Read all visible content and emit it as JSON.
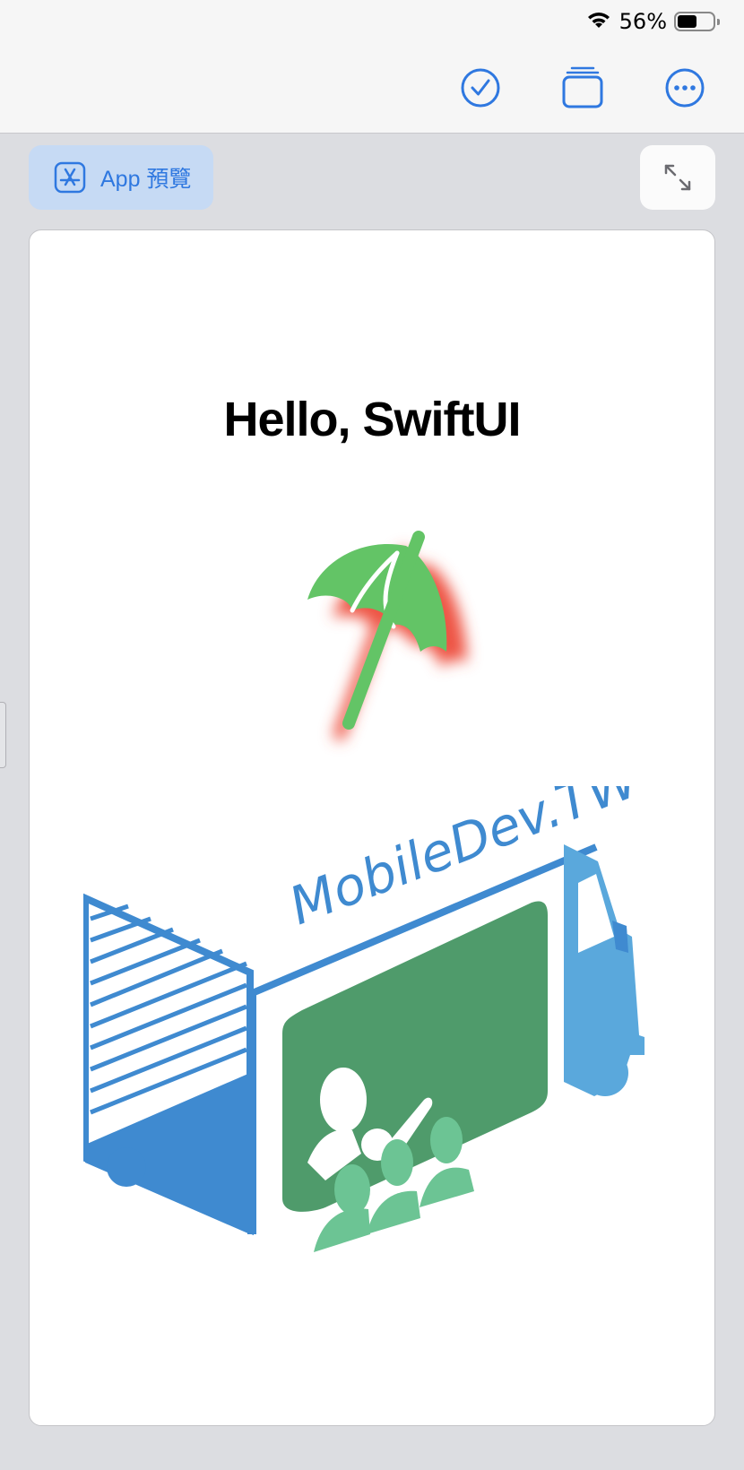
{
  "status_bar": {
    "battery_percent": "56%",
    "battery_level": 0.56
  },
  "toolbar": {
    "icons": [
      "checkmark-circle-icon",
      "stacked-windows-icon",
      "ellipsis-circle-icon"
    ]
  },
  "preview_button": {
    "label": "App 預覽",
    "icon": "app-store-icon"
  },
  "expand_button": {
    "icon": "expand-arrows-icon"
  },
  "canvas": {
    "title": "Hello, SwiftUI",
    "umbrella_icon": "beach-umbrella-icon",
    "logo_text": "MobileDev.TW"
  },
  "colors": {
    "accent": "#2f78e0",
    "umbrella_green": "#63c466",
    "shadow_red": "#ee5444",
    "truck_blue": "#3f8ad0",
    "truck_cab": "#5aa8dc",
    "screen_green": "#4f9b6b",
    "people_green": "#6cc494"
  }
}
